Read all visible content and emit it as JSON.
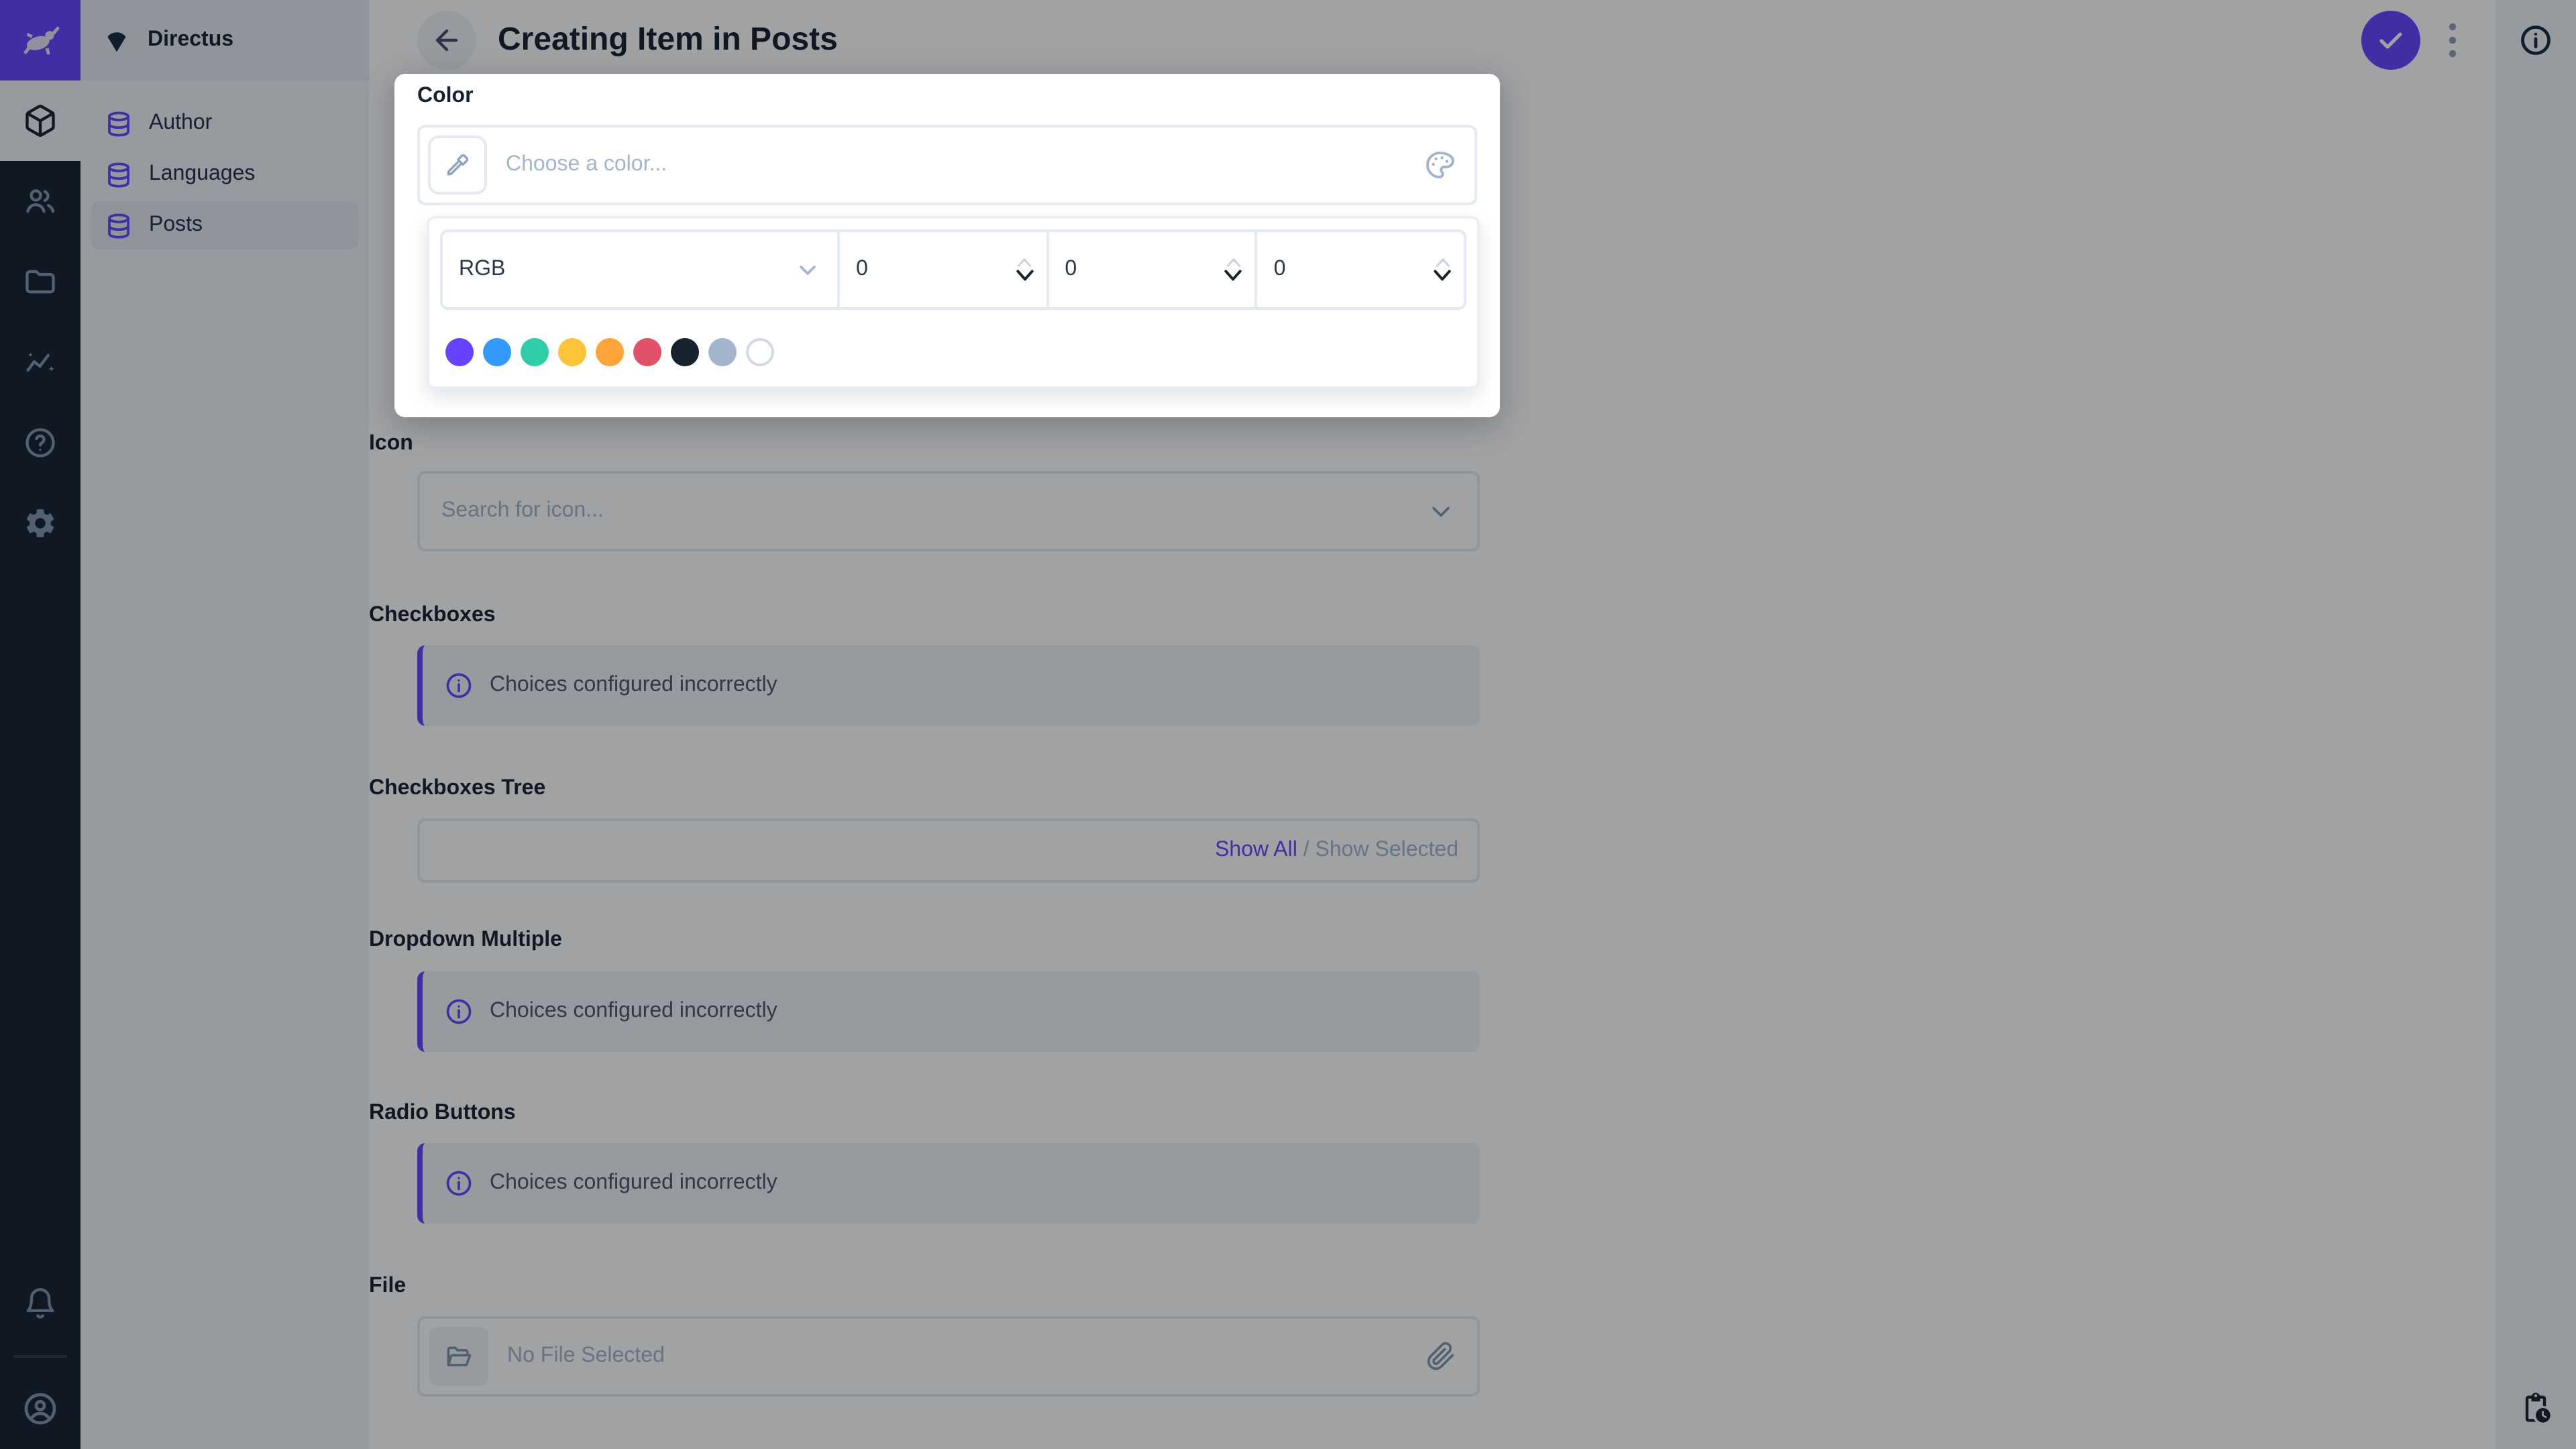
{
  "project": {
    "name": "Directus"
  },
  "header": {
    "title": "Creating Item in Posts"
  },
  "nav": {
    "items": [
      {
        "label": "Author",
        "active": false
      },
      {
        "label": "Languages",
        "active": false
      },
      {
        "label": "Posts",
        "active": true
      }
    ]
  },
  "color_picker": {
    "label": "Color",
    "input_placeholder": "Choose a color...",
    "mode": "RGB",
    "channels": [
      "0",
      "0",
      "0"
    ],
    "swatches": [
      "#6644FF",
      "#3399FF",
      "#2ECDA7",
      "#FFC23B",
      "#FFA439",
      "#E35169",
      "#18222F",
      "#A2B5CD",
      "#FFFFFF"
    ]
  },
  "fields": {
    "icon": {
      "label": "Icon",
      "placeholder": "Search for icon..."
    },
    "checkboxes": {
      "label": "Checkboxes",
      "notice": "Choices configured incorrectly"
    },
    "checkboxes_tree": {
      "label": "Checkboxes Tree",
      "show_all": "Show All",
      "separator": "/",
      "show_selected": "Show Selected"
    },
    "dropdown_multiple": {
      "label": "Dropdown Multiple",
      "notice": "Choices configured incorrectly"
    },
    "radio_buttons": {
      "label": "Radio Buttons",
      "notice": "Choices configured incorrectly"
    },
    "file": {
      "label": "File",
      "placeholder": "No File Selected"
    }
  },
  "colors": {
    "brand": "#6644FF",
    "module_bar_bg": "#18222F",
    "sidebar_bg": "#F0F4F9",
    "active_bg": "#E4EAF1",
    "border": "#E4EAF1",
    "text": "#18222F",
    "placeholder": "#A2B5CD",
    "icon_muted": "#8196AF"
  },
  "icons": [
    "directus-rabbit-logo",
    "project-shield-icon",
    "content-module-icon",
    "users-module-icon",
    "files-module-icon",
    "insights-module-icon",
    "help-module-icon",
    "settings-module-icon",
    "notifications-bell-icon",
    "user-avatar-icon",
    "database-icon",
    "arrow-left-icon",
    "check-icon",
    "kebab-menu-icon",
    "info-circle-icon",
    "eyedropper-icon",
    "palette-icon",
    "chevron-down-icon",
    "stepper-up-icon",
    "stepper-down-icon",
    "folder-open-icon",
    "paperclip-icon",
    "pending-actions-icon"
  ]
}
